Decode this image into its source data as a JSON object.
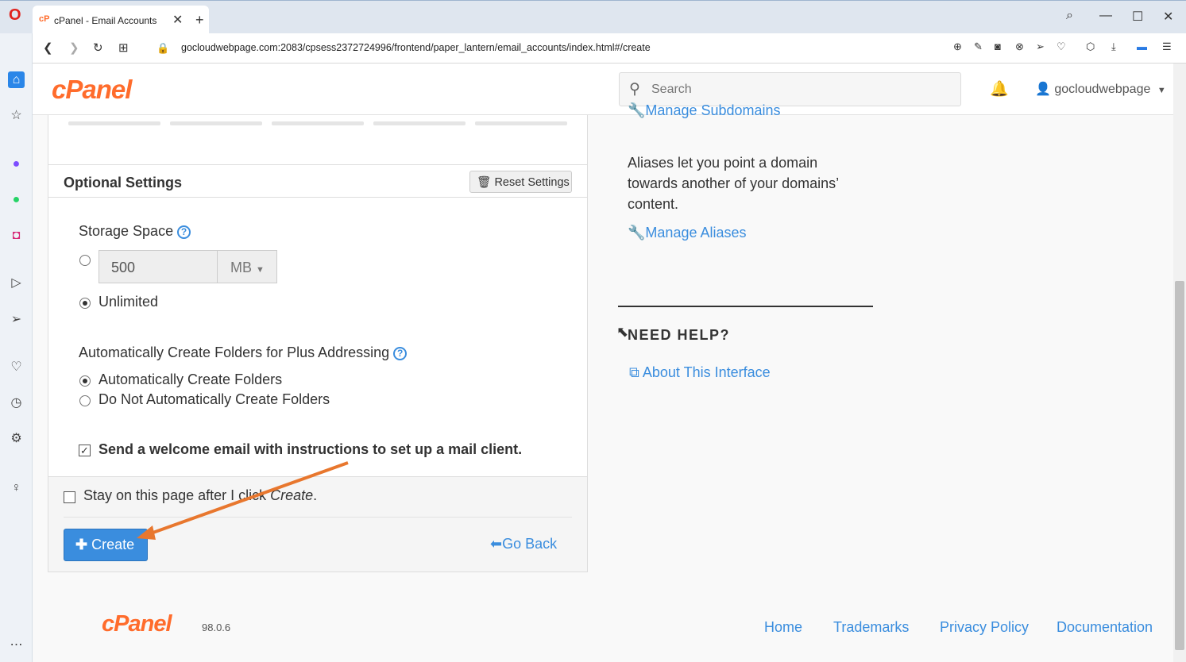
{
  "browser": {
    "tab_title": "cPanel - Email Accounts",
    "url": "gocloudwebpage.com:2083/cpsess2372724996/frontend/paper_lantern/email_accounts/index.html#/create"
  },
  "header": {
    "logo": "cPanel",
    "search_placeholder": "Search",
    "username": "gocloudwebpage"
  },
  "optional_settings": {
    "title": "Optional Settings",
    "reset_label": "Reset Settings",
    "storage": {
      "label": "Storage Space",
      "quota_value": "500",
      "unit": "MB",
      "unlimited_label": "Unlimited"
    },
    "plus_addressing": {
      "label": "Automatically Create Folders for Plus Addressing",
      "option_auto": "Automatically Create Folders",
      "option_no": "Do Not Automatically Create Folders"
    },
    "welcome_email_label": "Send a welcome email with instructions to set up a mail client."
  },
  "actions": {
    "stay_label_prefix": "Stay on this page after I click ",
    "stay_label_em": "Create",
    "stay_label_suffix": ".",
    "create_label": "Create",
    "go_back_label": "Go Back"
  },
  "right_column": {
    "manage_subdomains": "Manage Subdomains",
    "aliases_text": "Aliases let you point a domain towards another of your domains’ content.",
    "manage_aliases": "Manage Aliases",
    "need_help": "NEED HELP?",
    "about_interface": "About This Interface"
  },
  "footer": {
    "logo": "cPanel",
    "version": "98.0.6",
    "links": [
      "Home",
      "Trademarks",
      "Privacy Policy",
      "Documentation"
    ]
  },
  "colors": {
    "accent": "#3a8dde",
    "brand": "#ff6c2c",
    "annotation_arrow": "#e8772e"
  }
}
